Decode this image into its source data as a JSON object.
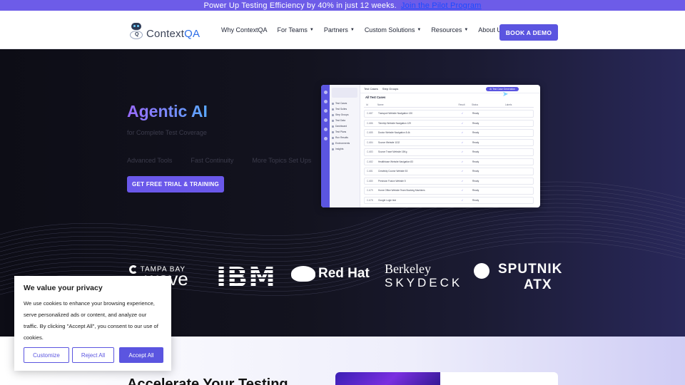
{
  "promo": {
    "text": "Power Up Testing Efficiency by 40% in just 12 weeks.",
    "link": "Join the Pilot Program"
  },
  "header": {
    "logo": {
      "prefix": "Context",
      "suffix": "QA",
      "icon": "robot-logo-icon"
    },
    "nav": [
      {
        "label": "Why ContextQA",
        "dropdown": false
      },
      {
        "label": "For Teams",
        "dropdown": true
      },
      {
        "label": "Partners",
        "dropdown": true
      },
      {
        "label": "Custom Solutions",
        "dropdown": true
      },
      {
        "label": "Resources",
        "dropdown": true
      },
      {
        "label": "About Us",
        "dropdown": false
      }
    ],
    "cta": "BOOK A DEMO"
  },
  "hero": {
    "title": "Agentic AI",
    "subtitle": "for Complete Test Coverage",
    "features": [
      "Advanced Tools",
      "Fast Continuity",
      "More Topics Set Ups"
    ],
    "cta": "GET FREE TRIAL & TRAINING"
  },
  "mockup": {
    "tabs": [
      "Test Cases",
      "Step Groups"
    ],
    "pill": "AI Test Case Generation",
    "title": "All Test Cases",
    "columns": [
      "Id",
      "Name",
      "Result",
      "Status",
      "Labels"
    ],
    "sidebar": [
      "Test Cases",
      "Test Suites",
      "Step Groups",
      "Test Data",
      "Dashboard",
      "Test Plans",
      "Run Results",
      "Environments",
      "Insights"
    ],
    "rows": [
      {
        "id": "C-687",
        "name": "Transport Website Navigation 130",
        "status": "Ready"
      },
      {
        "id": "C-686",
        "name": "Timetrip Website Navigation 129",
        "status": "Ready"
      },
      {
        "id": "C-685",
        "name": "Doctor Website Navigation 8.4k",
        "status": "Ready"
      },
      {
        "id": "C-684",
        "name": "Source Website 1132",
        "status": "Ready"
      },
      {
        "id": "C-683",
        "name": "Source Travel Website 15Kg",
        "status": "Ready"
      },
      {
        "id": "C-682",
        "name": "Healthbase Website Navigation 83",
        "status": "Ready"
      },
      {
        "id": "C-681",
        "name": "Creativity Course Website 53",
        "status": "Ready"
      },
      {
        "id": "C-680",
        "name": "Precision Fusion Website 5",
        "status": "Ready"
      },
      {
        "id": "C-679",
        "name": "Home Office Website Team Booking Machines",
        "status": "Ready"
      },
      {
        "id": "C-678",
        "name": "Google Login test",
        "status": "Ready"
      }
    ]
  },
  "logos": [
    "TAMPA BAY",
    "wave",
    "IBM",
    "Red Hat",
    "Berkeley",
    "SKYDECK",
    "SPUTNIK",
    "ATX"
  ],
  "cookie": {
    "title": "We value your privacy",
    "body": "We use cookies to enhance your browsing experience, serve personalized ads or content, and analyze our traffic. By clicking \"Accept All\", you consent to our use of cookies.",
    "customize": "Customize",
    "reject": "Reject All",
    "accept": "Accept All"
  },
  "section": {
    "title": "Accelerate Your Testing"
  },
  "colors": {
    "accent": "#5b55e0",
    "promo_bg": "#6d5ce8",
    "hero_bg": "#13131f",
    "link": "#1d4bff"
  }
}
